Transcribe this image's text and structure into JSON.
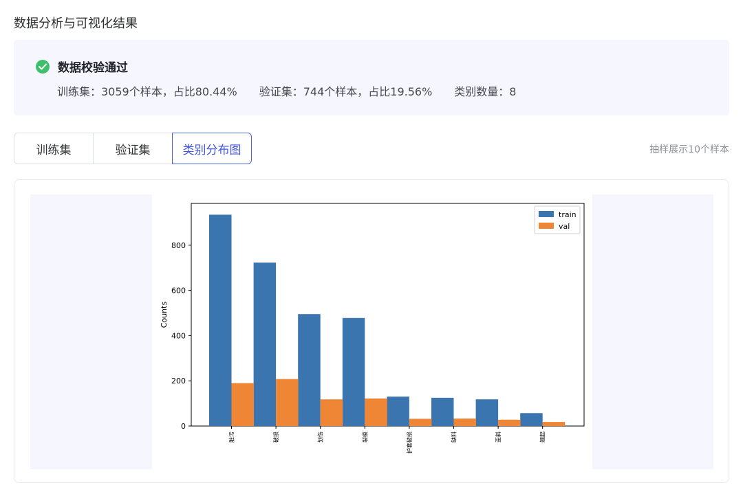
{
  "section_title": "数据分析与可视化结果",
  "validation": {
    "title": "数据校验通过",
    "train_stat": "训练集：3059个样本，占比80.44%",
    "val_stat": "验证集：744个样本，占比19.56%",
    "class_stat": "类别数量：8"
  },
  "tabs": [
    {
      "label": "训练集",
      "active": false
    },
    {
      "label": "验证集",
      "active": false
    },
    {
      "label": "类别分布图",
      "active": true
    }
  ],
  "sample_hint": "抽样展示10个样本",
  "colors": {
    "train": "#3a75b0",
    "val": "#ee8636",
    "accent": "#4a62e8",
    "success": "#3fbf6c"
  },
  "chart_data": {
    "type": "bar",
    "categories": [
      "脏污",
      "破损",
      "划伤",
      "裂痕",
      "护套破损",
      "缺料",
      "歪斜",
      "翘起"
    ],
    "series": [
      {
        "name": "train",
        "values": [
          935,
          723,
          495,
          478,
          130,
          125,
          118,
          57
        ]
      },
      {
        "name": "val",
        "values": [
          190,
          208,
          118,
          122,
          32,
          33,
          28,
          18
        ]
      }
    ],
    "ylabel": "Counts",
    "xlabel": "",
    "ylim": [
      0,
      985
    ],
    "yticks": [
      0,
      200,
      400,
      600,
      800
    ],
    "legend_position": "top-right",
    "grid": false
  }
}
